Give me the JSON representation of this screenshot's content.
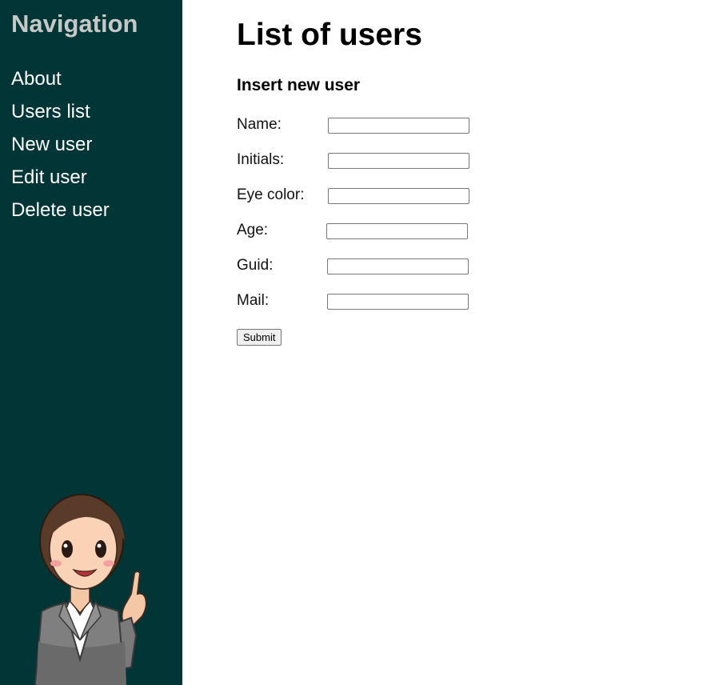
{
  "sidebar": {
    "title": "Navigation",
    "items": [
      {
        "label": "About"
      },
      {
        "label": "Users list"
      },
      {
        "label": "New user"
      },
      {
        "label": "Edit user"
      },
      {
        "label": "Delete user"
      }
    ],
    "background_color": "#023535",
    "mascot_icon": "pointing-businesswoman-icon"
  },
  "main": {
    "title": "List of users",
    "form": {
      "title": "Insert new user",
      "fields": [
        {
          "label": "Name:",
          "value": ""
        },
        {
          "label": "Initials:",
          "value": ""
        },
        {
          "label": "Eye color:",
          "value": ""
        },
        {
          "label": "Age:",
          "value": ""
        },
        {
          "label": "Guid:",
          "value": ""
        },
        {
          "label": "Mail:",
          "value": ""
        }
      ],
      "submit_label": "Submit"
    }
  }
}
